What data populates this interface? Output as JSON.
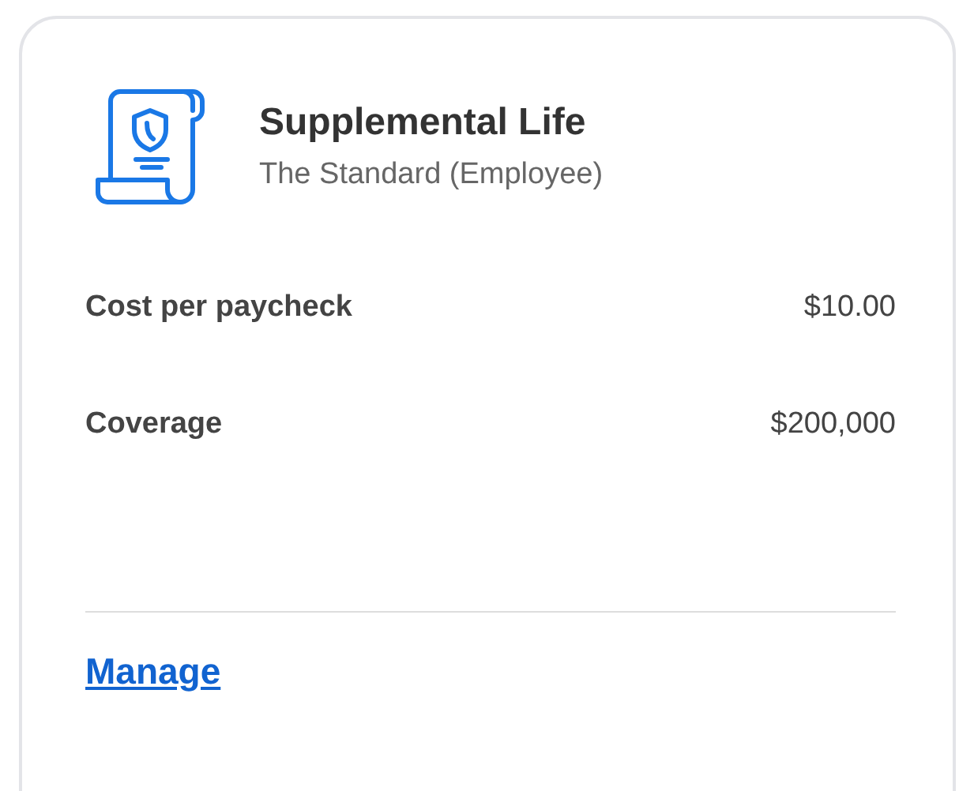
{
  "card": {
    "title": "Supplemental Life",
    "subtitle": "The Standard (Employee)",
    "rows": [
      {
        "label": "Cost per paycheck",
        "value": "$10.00"
      },
      {
        "label": "Coverage",
        "value": "$200,000"
      }
    ],
    "link": "Manage"
  }
}
